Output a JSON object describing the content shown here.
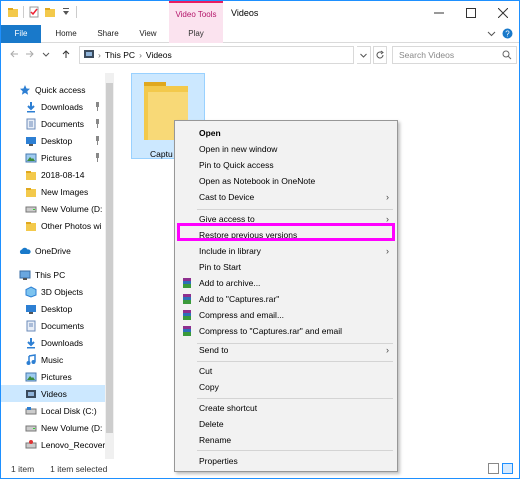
{
  "window": {
    "title": "Videos",
    "context_tab_title": "Video Tools"
  },
  "ribbon": {
    "tabs": [
      "File",
      "Home",
      "Share",
      "View",
      "Play"
    ]
  },
  "address": {
    "path": [
      "This PC",
      "Videos"
    ],
    "search_placeholder": "Search Videos"
  },
  "nav": {
    "items": [
      {
        "label": "Quick access",
        "icon": "star-icon",
        "pinned": false
      },
      {
        "label": "Downloads",
        "icon": "download-icon",
        "pinned": true
      },
      {
        "label": "Documents",
        "icon": "document-icon",
        "pinned": true
      },
      {
        "label": "Desktop",
        "icon": "desktop-icon",
        "pinned": true
      },
      {
        "label": "Pictures",
        "icon": "pictures-icon",
        "pinned": true
      },
      {
        "label": "2018-08-14",
        "icon": "folder-icon",
        "pinned": false
      },
      {
        "label": "New Images",
        "icon": "folder-icon",
        "pinned": false
      },
      {
        "label": "New Volume (D:",
        "icon": "drive-icon",
        "pinned": false
      },
      {
        "label": "Other Photos wi",
        "icon": "folder-icon",
        "pinned": false
      },
      {
        "label": "OneDrive",
        "icon": "onedrive-icon",
        "pinned": false
      },
      {
        "label": "This PC",
        "icon": "pc-icon",
        "pinned": false
      },
      {
        "label": "3D Objects",
        "icon": "3d-objects-icon",
        "pinned": false
      },
      {
        "label": "Desktop",
        "icon": "desktop-icon",
        "pinned": false
      },
      {
        "label": "Documents",
        "icon": "document-icon",
        "pinned": false
      },
      {
        "label": "Downloads",
        "icon": "download-icon",
        "pinned": false
      },
      {
        "label": "Music",
        "icon": "music-icon",
        "pinned": false
      },
      {
        "label": "Pictures",
        "icon": "pictures-icon",
        "pinned": false
      },
      {
        "label": "Videos",
        "icon": "videos-icon",
        "pinned": false,
        "selected": true
      },
      {
        "label": "Local Disk (C:)",
        "icon": "drive-icon",
        "pinned": false
      },
      {
        "label": "New Volume (D:",
        "icon": "drive-icon",
        "pinned": false
      },
      {
        "label": "Lenovo_Recover",
        "icon": "drive-icon",
        "pinned": false
      }
    ]
  },
  "content": {
    "folder_label": "Captu"
  },
  "context_menu": {
    "items": [
      {
        "label": "Open",
        "bold": true
      },
      {
        "label": "Open in new window"
      },
      {
        "label": "Pin to Quick access"
      },
      {
        "label": "Open as Notebook in OneNote"
      },
      {
        "label": "Cast to Device",
        "submenu": true
      },
      {
        "sep": true
      },
      {
        "label": "Give access to",
        "submenu": true
      },
      {
        "label": "Restore previous versions",
        "highlighted": true
      },
      {
        "label": "Include in library",
        "submenu": true
      },
      {
        "label": "Pin to Start"
      },
      {
        "label": "Add to archive...",
        "icon": "winrar-icon"
      },
      {
        "label": "Add to \"Captures.rar\"",
        "icon": "winrar-icon"
      },
      {
        "label": "Compress and email...",
        "icon": "winrar-icon"
      },
      {
        "label": "Compress to \"Captures.rar\" and email",
        "icon": "winrar-icon"
      },
      {
        "sep": true
      },
      {
        "label": "Send to",
        "submenu": true
      },
      {
        "sep": true
      },
      {
        "label": "Cut"
      },
      {
        "label": "Copy"
      },
      {
        "sep": true
      },
      {
        "label": "Create shortcut"
      },
      {
        "label": "Delete"
      },
      {
        "label": "Rename"
      },
      {
        "sep": true
      },
      {
        "label": "Properties"
      }
    ]
  },
  "status": {
    "count": "1 item",
    "selected": "1 item selected"
  },
  "colors": {
    "accent": "#1979ca",
    "highlight": "#ff00ff",
    "selected_bg": "#cce8ff",
    "video_tools": "#fbe3ef"
  }
}
